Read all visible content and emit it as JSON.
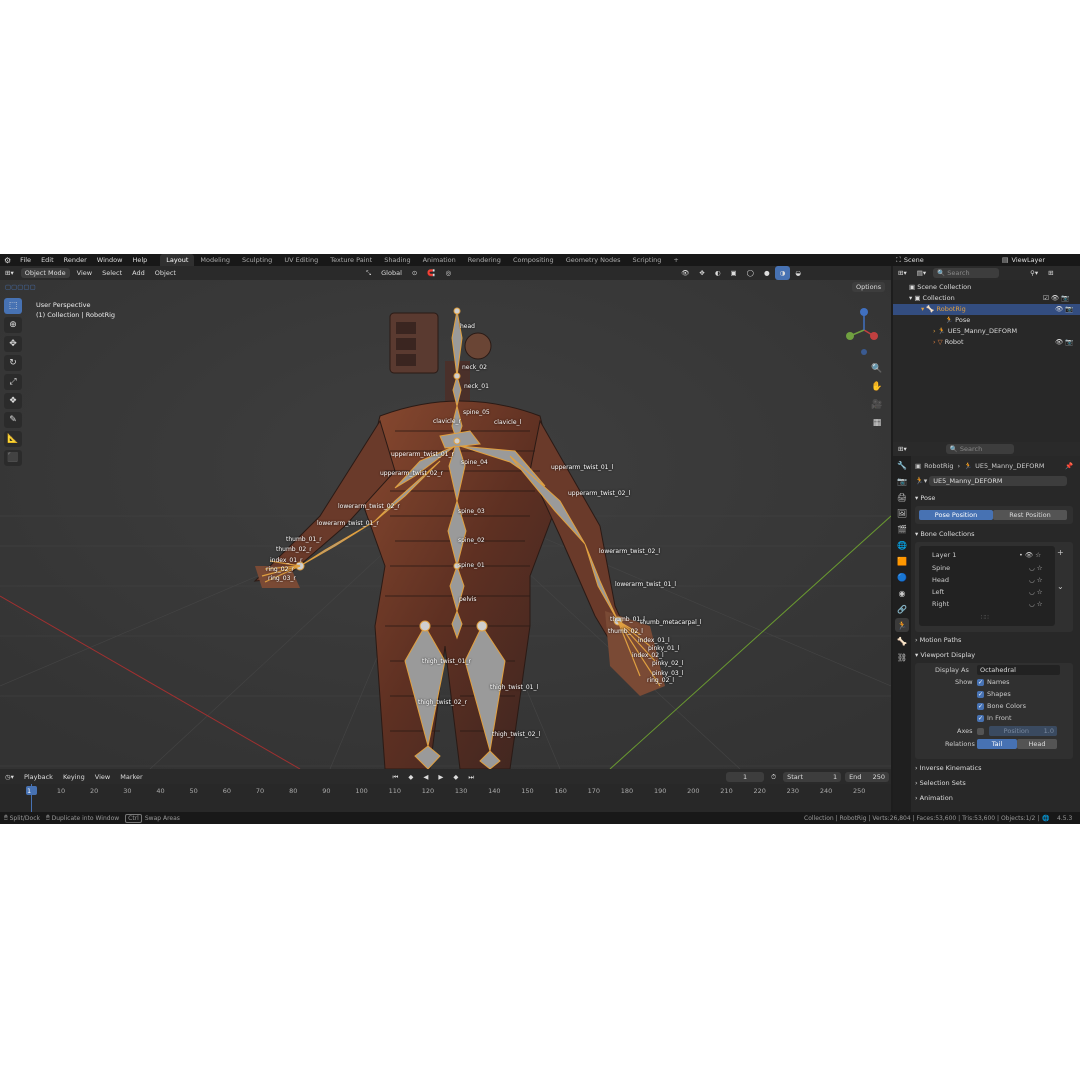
{
  "menu": [
    "File",
    "Edit",
    "Render",
    "Window",
    "Help"
  ],
  "workspaces": [
    "Layout",
    "Modeling",
    "Sculpting",
    "UV Editing",
    "Texture Paint",
    "Shading",
    "Animation",
    "Rendering",
    "Compositing",
    "Geometry Nodes",
    "Scripting"
  ],
  "active_workspace": "Layout",
  "scene_name": "Scene",
  "view_layer": "ViewLayer",
  "viewport": {
    "mode": "Object Mode",
    "menus": [
      "View",
      "Select",
      "Add",
      "Object"
    ],
    "transform_orientation": "Global",
    "options_label": "Options",
    "overlay_line1": "User Perspective",
    "overlay_line2": "(1) Collection | RobotRig"
  },
  "bones": [
    {
      "name": "head"
    },
    {
      "name": "neck_02"
    },
    {
      "name": "neck_01"
    },
    {
      "name": "spine_05"
    },
    {
      "name": "clavicle_r"
    },
    {
      "name": "clavicle_l"
    },
    {
      "name": "upperarm_twist_01_r"
    },
    {
      "name": "spine_04"
    },
    {
      "name": "upperarm_twist_02_r"
    },
    {
      "name": "upperarm_twist_01_l"
    },
    {
      "name": "upperarm_twist_02_l"
    },
    {
      "name": "lowerarm_twist_02_r"
    },
    {
      "name": "spine_03"
    },
    {
      "name": "lowerarm_twist_01_r"
    },
    {
      "name": "spine_02"
    },
    {
      "name": "lowerarm_twist_02_l"
    },
    {
      "name": "spine_01"
    },
    {
      "name": "lowerarm_twist_01_l"
    },
    {
      "name": "pelvis"
    },
    {
      "name": "thigh_twist_01_r"
    },
    {
      "name": "thigh_twist_01_l"
    },
    {
      "name": "thigh_twist_02_r"
    },
    {
      "name": "thigh_twist_02_l"
    },
    {
      "name": "thumb_metacarpal_l"
    },
    {
      "name": "thumb_01_l"
    },
    {
      "name": "thumb_02_l"
    },
    {
      "name": "index_01_l"
    },
    {
      "name": "index_02_l"
    },
    {
      "name": "pinky_01_l"
    },
    {
      "name": "pinky_02_l"
    },
    {
      "name": "pinky_03_l"
    },
    {
      "name": "ring_02_l"
    },
    {
      "name": "thumb_01_r"
    },
    {
      "name": "thumb_02_r"
    },
    {
      "name": "index_01_r"
    },
    {
      "name": "ring_02_r"
    },
    {
      "name": "ring_03_r"
    }
  ],
  "timeline": {
    "menus": [
      "Playback",
      "Keying",
      "View",
      "Marker"
    ],
    "current_frame": "1",
    "start_label": "Start",
    "start": "1",
    "end_label": "End",
    "end": "250",
    "ticks": [
      "1",
      "10",
      "20",
      "30",
      "40",
      "50",
      "60",
      "70",
      "80",
      "90",
      "100",
      "110",
      "120",
      "130",
      "140",
      "150",
      "160",
      "170",
      "180",
      "190",
      "200",
      "210",
      "220",
      "230",
      "240",
      "250"
    ]
  },
  "status": {
    "left1": "Split/Dock",
    "left2": "Duplicate into Window",
    "key": "Ctrl",
    "left3": "Swap Areas",
    "right": "Collection | RobotRig | Verts:26,804 | Faces:53,600 | Tris:53,600 | Objects:1/2 |",
    "version": "4.5.3"
  },
  "outliner": {
    "search_placeholder": "Search",
    "items": [
      {
        "label": "Scene Collection"
      },
      {
        "label": "Collection"
      },
      {
        "label": "RobotRig"
      },
      {
        "label": "Pose"
      },
      {
        "label": "UE5_Manny_DEFORM"
      },
      {
        "label": "Robot"
      }
    ]
  },
  "properties": {
    "search_placeholder": "Search",
    "breadcrumb_obj": "RobotRig",
    "breadcrumb_data": "UE5_Manny_DEFORM",
    "data_name": "UE5_Manny_DEFORM",
    "pose_panel": "Pose",
    "pose_position": "Pose Position",
    "rest_position": "Rest Position",
    "bone_collections_panel": "Bone Collections",
    "bone_collections": [
      "Layer 1",
      "Spine",
      "Head",
      "Left",
      "Right"
    ],
    "motion_paths": "Motion Paths",
    "viewport_display": "Viewport Display",
    "display_as_label": "Display As",
    "display_as_value": "Octahedral",
    "show_label": "Show",
    "show_items": [
      "Names",
      "Shapes",
      "Bone Colors",
      "In Front"
    ],
    "axes_label": "Axes",
    "axes_position": "Position",
    "axes_value": "1.0",
    "relations_label": "Relations",
    "relations_tail": "Tail",
    "relations_head": "Head",
    "inverse_kinematics": "Inverse Kinematics",
    "selection_sets": "Selection Sets",
    "animation": "Animation"
  },
  "colors": {
    "accent": "#4772b3",
    "bone": "#e0a040",
    "selected": "#334d80",
    "grid_x": "#a03030",
    "grid_y": "#6a9a30"
  }
}
